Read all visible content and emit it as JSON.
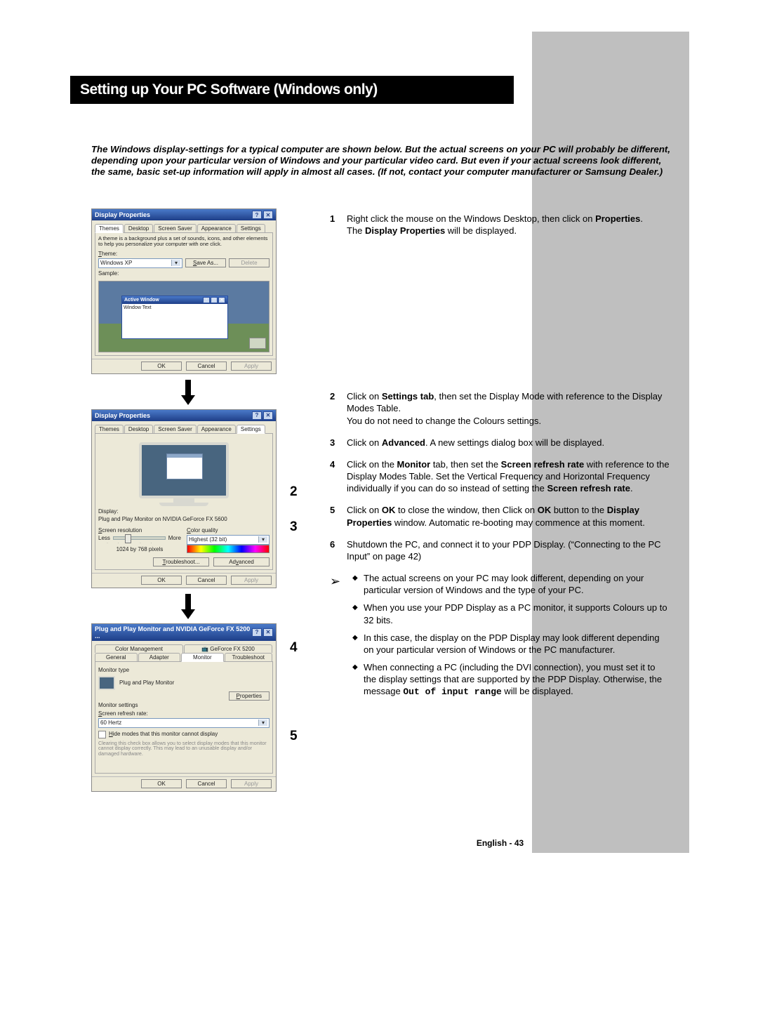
{
  "title": "Setting up Your PC Software (Windows only)",
  "intro": "The Windows display-settings for a typical computer are shown below. But the actual screens on your PC will probably be different, depending upon your particular version of Windows and your particular video card. But even if your actual screens look different, the same, basic set-up information will apply in almost all cases. (If not, contact your computer manufacturer or Samsung Dealer.)",
  "dlg_title": "Display Properties",
  "dlg3_title": "Plug and Play Monitor and NVIDIA GeForce FX 5200 ...",
  "tabs1": {
    "t0": "Themes",
    "t1": "Desktop",
    "t2": "Screen Saver",
    "t3": "Appearance",
    "t4": "Settings"
  },
  "d1": {
    "desc": "A theme is a background plus a set of sounds, icons, and other elements to help you personalize your computer with one click.",
    "theme_lbl": "Theme:",
    "theme_val": "Windows XP",
    "save_as": "Save As...",
    "delete": "Delete",
    "sample": "Sample:",
    "active_window": "Active Window",
    "window_text": "Window Text"
  },
  "d2": {
    "display_lbl": "Display:",
    "display_val": "Plug and Play Monitor on NVIDIA GeForce FX 5600",
    "res_lbl": "Screen resolution",
    "less": "Less",
    "more": "More",
    "res_val": "1024 by 768 pixels",
    "cq_lbl": "Color quality",
    "cq_val": "Highest (32 bit)",
    "troubleshoot": "Troubleshoot...",
    "advanced": "Advanced"
  },
  "tabs3a": {
    "t0": "Color Management",
    "t1": "GeForce FX 5200"
  },
  "tabs3b": {
    "t0": "General",
    "t1": "Adapter",
    "t2": "Monitor",
    "t3": "Troubleshoot"
  },
  "d3": {
    "mt_lbl": "Monitor type",
    "mt_val": "Plug and Play Monitor",
    "properties": "Properties",
    "ms_lbl": "Monitor settings",
    "srr_lbl": "Screen refresh rate:",
    "srr_val": "60 Hertz",
    "hide": "Hide modes that this monitor cannot display",
    "note": "Clearing this check box allows you to select display modes that this monitor cannot display correctly. This may lead to an unusable display and/or damaged hardware."
  },
  "buttons": {
    "ok": "OK",
    "cancel": "Cancel",
    "apply": "Apply"
  },
  "callouts": {
    "c2": "2",
    "c3": "3",
    "c4": "4",
    "c5": "5"
  },
  "steps": {
    "s1": {
      "n": "1",
      "a": "Right click the mouse on the Windows Desktop, then click on ",
      "b": "Properties",
      "c": ".",
      "d": "The ",
      "e": "Display Properties",
      "f": " will be displayed."
    },
    "s2": {
      "n": "2",
      "a": "Click on ",
      "b": "Settings tab",
      "c": ", then set the Display Mode with reference to the Display Modes Table.",
      "d": "You do not need to change the Colours settings."
    },
    "s3": {
      "n": "3",
      "a": "Click on ",
      "b": "Advanced",
      "c": ". A new settings dialog box will be displayed."
    },
    "s4": {
      "n": "4",
      "a": "Click on the ",
      "b": "Monitor",
      "c": " tab, then set the ",
      "d": "Screen refresh rate",
      "e": " with reference to the Display Modes Table. Set the Vertical Frequency and Horizontal Frequency individually if you can do so instead of setting the ",
      "f": "Screen refresh rate",
      "g": "."
    },
    "s5": {
      "n": "5",
      "a": "Click on ",
      "b": "OK",
      "c": " to close the window, then Click on ",
      "d": "OK",
      "e": " button to the ",
      "f": "Display Properties",
      "g": " window. Automatic re-booting may commence at this moment."
    },
    "s6": {
      "n": "6",
      "a": "Shutdown the PC, and connect it to your PDP Display. (“Connecting to the PC Input” on page 42)"
    }
  },
  "notes": {
    "n1": "The actual screens on your PC may look different, depending on your particular version of Windows and the type of your PC.",
    "n2": "When you use your PDP Display as a PC monitor, it supports Colours up to 32 bits.",
    "n3": "In this case, the display on the PDP Display may look different depending on your particular version of Windows or the PC manufacturer.",
    "n4a": "When connecting a PC (including the DVI connection), you must set it to the display settings that are supported by the PDP Display. Otherwise, the message ",
    "n4b": "Out of input range",
    "n4c": " will be displayed."
  },
  "footer": "English - 43"
}
